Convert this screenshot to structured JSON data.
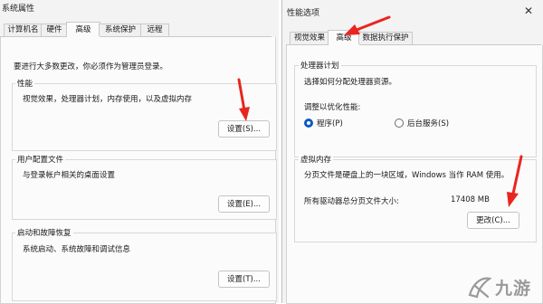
{
  "left_window": {
    "title": "系统属性",
    "tabs": [
      "计算机名",
      "硬件",
      "高级",
      "系统保护",
      "远程"
    ],
    "active_tab": "高级",
    "admin_note": "要进行大多数更改，你必须作为管理员登录。",
    "performance": {
      "title": "性能",
      "desc": "视觉效果，处理器计划，内存使用，以及虚拟内存",
      "button": "设置(S)..."
    },
    "user_profile": {
      "title": "用户配置文件",
      "desc": "与登录帐户相关的桌面设置",
      "button": "设置(E)..."
    },
    "startup_recovery": {
      "title": "启动和故障恢复",
      "desc": "系统启动、系统故障和调试信息",
      "button": "设置(T)..."
    }
  },
  "right_window": {
    "title": "性能选项",
    "close": "✕",
    "tabs": [
      "视觉效果",
      "高级",
      "数据执行保护"
    ],
    "active_tab": "高级",
    "processor": {
      "title": "处理器计划",
      "desc": "选择如何分配处理器资源。",
      "adjust_label": "调整以优化性能:",
      "options": [
        "程序(P)",
        "后台服务(S)"
      ],
      "selected": "程序(P)"
    },
    "virtual_memory": {
      "title": "虚拟内存",
      "desc": "分页文件是硬盘上的一块区域，Windows 当作 RAM 使用。",
      "total_label": "所有驱动器总分页文件大小:",
      "total_value": "17408 MB",
      "button": "更改(C)..."
    }
  },
  "watermark": "九游",
  "colors": {
    "arrow": "#e8261f",
    "radio_selected": "#0a5bc4",
    "watermark": "#9a9a9a"
  }
}
